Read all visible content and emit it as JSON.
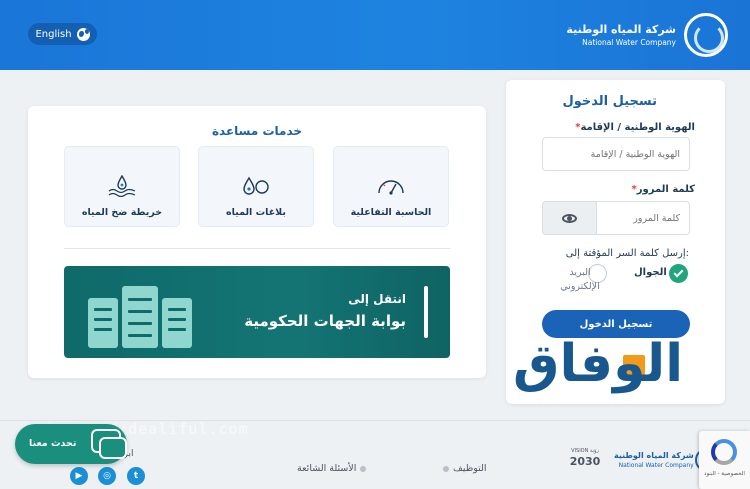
{
  "header": {
    "lang_button": "English",
    "brand_ar": "شركة المياه الوطنية",
    "brand_en": "National Water Company"
  },
  "login": {
    "title": "تسجيل الدخول",
    "id_label": "الهوية الوطنية / الإقامة",
    "id_placeholder": "الهوية الوطنية / الإقامة",
    "password_label": "كلمة المرور",
    "password_placeholder": "كلمة المرور",
    "required_mark": "*",
    "send_label": "إرسل كلمة السر المؤقتة إلى:",
    "option_mobile": "الجوال",
    "option_email": "البريد الإلكتروني",
    "submit": "تسجيل الدخول"
  },
  "watermark": {
    "text": "الوفاق"
  },
  "services": {
    "title": "خدمات مساعدة",
    "items": [
      {
        "label": "الحاسبة التفاعلية",
        "icon": "gauge-icon"
      },
      {
        "label": "بلاغات المياه",
        "icon": "water-report-icon"
      },
      {
        "label": "خريطة ضخ المياه",
        "icon": "water-map-icon"
      }
    ],
    "gov_small": "انتقل إلى",
    "gov_big": "بوابة الجهات الحكومية"
  },
  "footer": {
    "links": [
      "التوظيف",
      "الأسئلة الشائعة"
    ],
    "follow": "ابق",
    "social": [
      {
        "name": "twitter-icon",
        "glyph": "t"
      },
      {
        "name": "instagram-icon",
        "glyph": "◎"
      },
      {
        "name": "youtube-icon",
        "glyph": "▶"
      }
    ],
    "brand_ar": "شركة المياه الوطنية",
    "brand_en": "National Water Company",
    "vision_num": "2030",
    "vision_sub": "VISION رؤية",
    "chat": "تحدث معنا",
    "url_watermark": "https://dealiful.com",
    "recaptcha": "الخصوصية - البنود"
  },
  "colors": {
    "header_blue": "#1a76d8",
    "title_blue": "#1d5fa7",
    "teal": "#0f6a6a",
    "green_check": "#21a57f",
    "required_red": "#e53935"
  }
}
